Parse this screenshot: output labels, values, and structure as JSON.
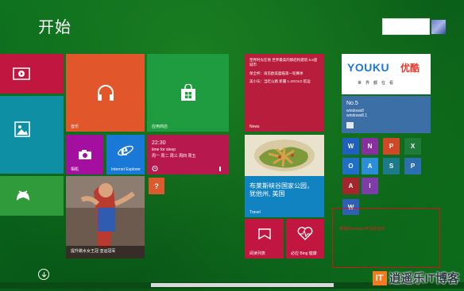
{
  "header": {
    "title": "开始"
  },
  "colors": {
    "bg": "#0a5f1a",
    "red": "#d11414",
    "orange": "#f37a1f"
  },
  "tiles": {
    "music": {
      "label": "音乐"
    },
    "store": {
      "label": "应用商店"
    },
    "camera": {
      "label": "相机"
    },
    "ie": {
      "label": "Internet Explorer"
    },
    "alarm": {
      "time": "22:30",
      "text": "time for sleep",
      "days": "周一 周二 周三 周四 周五"
    },
    "sports": {
      "label": "提升跳水女王冠 亚运冠军"
    },
    "news": {
      "label": "News",
      "lines": [
        "塑界时光在地 世界最美的钢结构建筑 5.5座城市",
        "保全杯：再见欧美面临第一轮赛季",
        "美小乐：当赶公路 新疆 1.4GOLD 航运"
      ]
    },
    "travel": {
      "line1": "布莱斯峡谷国家公园，",
      "line2": "犹他州, 美国",
      "label": "Travel"
    },
    "reading": {
      "label": "阅读列表"
    },
    "health": {
      "label": "必应 Bing 健康"
    },
    "youku": {
      "logo": "YOUKU",
      "cn": "优酷",
      "slogan": "世界都在看"
    },
    "win81": {
      "no": "No.5",
      "os1": "windows8",
      "os2": "windows8.1"
    },
    "apps": [
      "W",
      "N",
      "P",
      "X",
      "O",
      "A",
      "S",
      "P",
      "A",
      "I",
      "W"
    ]
  },
  "note": {
    "text": "新装的vmware开没有显示"
  },
  "icons": {
    "video": "video-icon",
    "music": "headphones-icon",
    "store": "store-bag-icon",
    "photos": "photos-icon",
    "games": "xbox-controller-icon",
    "camera": "camera-icon",
    "ie": "internet-explorer-icon",
    "alarm": "alarm-icon",
    "help": "help-icon",
    "reading": "reading-list-icon",
    "health": "heart-pulse-icon",
    "down": "down-arrow-icon"
  },
  "watermark": {
    "box": "IT",
    "text": "逍遥乐IT博客"
  }
}
